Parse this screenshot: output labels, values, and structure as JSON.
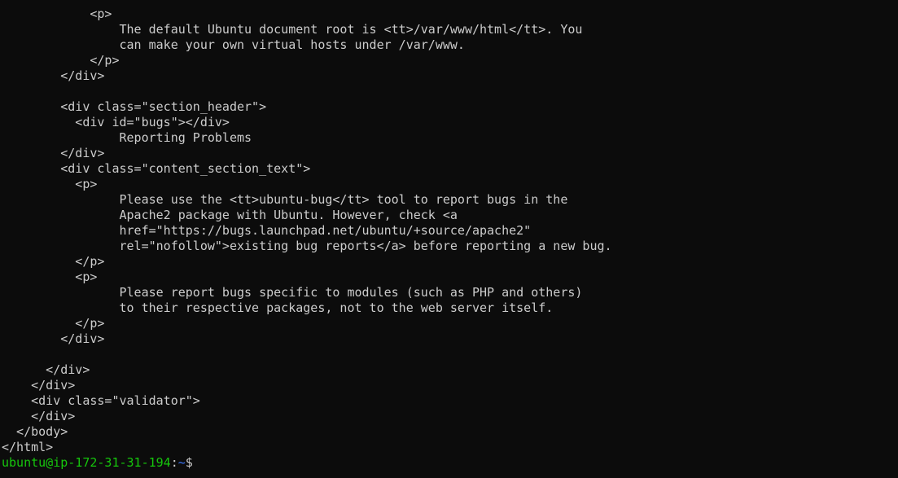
{
  "colors": {
    "background": "#0c0c0c",
    "foreground": "#cccccc",
    "prompt_user": "#16c60c",
    "prompt_path": "#3b78ff"
  },
  "output_lines": [
    "            <p>",
    "                The default Ubuntu document root is <tt>/var/www/html</tt>. You",
    "                can make your own virtual hosts under /var/www.",
    "            </p>",
    "        </div>",
    "",
    "        <div class=\"section_header\">",
    "          <div id=\"bugs\"></div>",
    "                Reporting Problems",
    "        </div>",
    "        <div class=\"content_section_text\">",
    "          <p>",
    "                Please use the <tt>ubuntu-bug</tt> tool to report bugs in the",
    "                Apache2 package with Ubuntu. However, check <a",
    "                href=\"https://bugs.launchpad.net/ubuntu/+source/apache2\"",
    "                rel=\"nofollow\">existing bug reports</a> before reporting a new bug.",
    "          </p>",
    "          <p>",
    "                Please report bugs specific to modules (such as PHP and others)",
    "                to their respective packages, not to the web server itself.",
    "          </p>",
    "        </div>",
    "",
    "      </div>",
    "    </div>",
    "    <div class=\"validator\">",
    "    </div>",
    "  </body>",
    "</html>"
  ],
  "prompt": {
    "user_host": "ubuntu@ip-172-31-31-194",
    "separator": ":",
    "path": "~",
    "symbol": "$"
  }
}
